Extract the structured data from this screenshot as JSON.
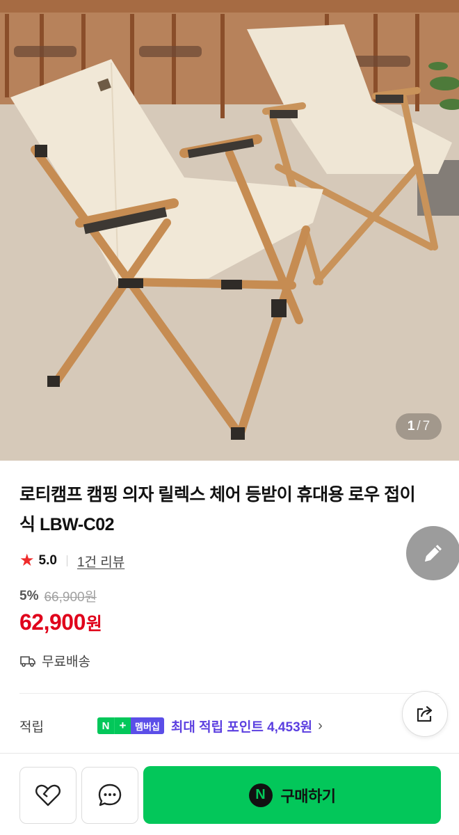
{
  "gallery": {
    "current": "1",
    "separator": "/",
    "total": "7"
  },
  "product": {
    "title": "로티캠프 캠핑 의자 릴렉스 체어 등받이 휴대용 로우 접이식 LBW-C02",
    "rating": "5.0",
    "review_link": "1건 리뷰",
    "discount_rate": "5%",
    "original_price": "66,900원",
    "sale_price": "62,900",
    "sale_price_unit": "원",
    "shipping": "무료배송"
  },
  "points": {
    "label": "적립",
    "badge_n": "N",
    "badge_plus": "+",
    "badge_membership": "멤버십",
    "text": "최대 적립 포인트 4,453원",
    "chevron": "›"
  },
  "actions": {
    "buy_logo": "N",
    "buy_label": "구매하기"
  },
  "icons": {
    "rating": "star-icon",
    "shipping": "truck-icon",
    "edit": "pencil-icon",
    "share": "share-icon",
    "like": "heart-icon",
    "chat": "chat-bubble-icon"
  },
  "colors": {
    "sale_red": "#e0001b",
    "star_red": "#ef2b2b",
    "naver_green": "#03c75a",
    "points_purple": "#5b3fe0"
  }
}
